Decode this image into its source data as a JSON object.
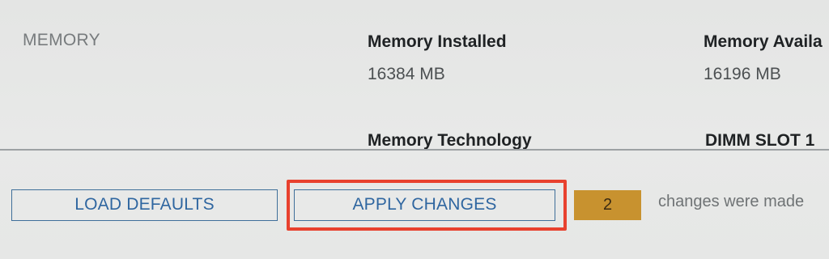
{
  "section": {
    "label": "MEMORY"
  },
  "fields": {
    "memory_installed": {
      "title": "Memory Installed",
      "value": "16384 MB"
    },
    "memory_available": {
      "title": "Memory Availa",
      "value": "16196 MB"
    },
    "memory_technology": {
      "title": "Memory Technology"
    },
    "dimm_slot": {
      "title": "DIMM  SLOT 1"
    }
  },
  "actions": {
    "load_defaults_label": "LOAD DEFAULTS",
    "apply_changes_label": "APPLY CHANGES"
  },
  "changes": {
    "count": "2",
    "message": "changes were made"
  },
  "colors": {
    "button_text": "#2f66a0",
    "highlight_border": "#e8412e",
    "badge_bg": "#c8922f"
  }
}
